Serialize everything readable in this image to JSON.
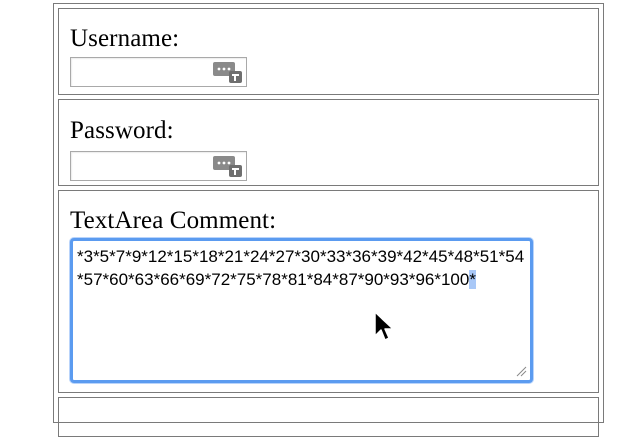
{
  "form": {
    "username": {
      "label": "Username:",
      "value": "",
      "icon": "password-manager-key-icon"
    },
    "password": {
      "label": "Password:",
      "value": "",
      "icon": "password-manager-key-icon"
    },
    "comment": {
      "label": "TextArea Comment:",
      "value": "*3*5*7*9*12*15*18*21*24*27*30*33*36*39*42*45*48*51*54*57*60*63*66*69*72*75*78*81*84*87*90*93*96*100",
      "selected_text": "*",
      "focused": true
    }
  },
  "colors": {
    "focus_ring": "#5b9bf0",
    "selection": "#a9c8f7",
    "border": "#7a7a7a"
  }
}
